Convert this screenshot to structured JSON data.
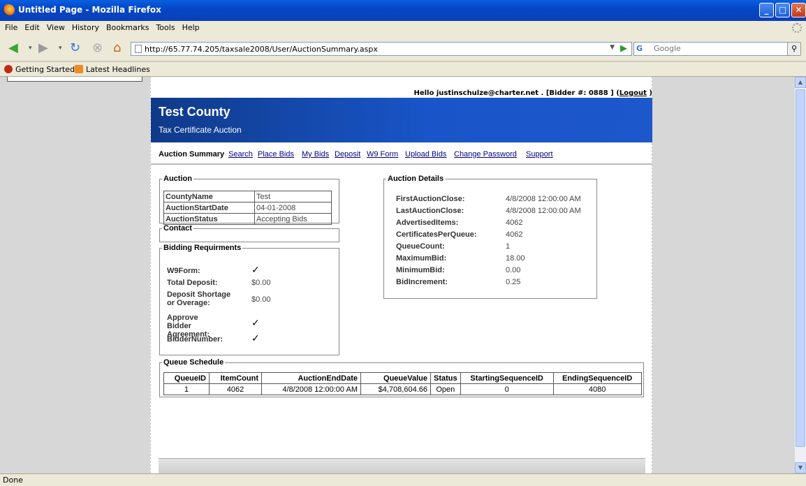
{
  "window": {
    "title": "Untitled Page - Mozilla Firefox"
  },
  "menu": [
    "File",
    "Edit",
    "View",
    "History",
    "Bookmarks",
    "Tools",
    "Help"
  ],
  "address": {
    "url": "http://65.77.74.205/taxsale2008/User/AuctionSummary.aspx"
  },
  "search": {
    "placeholder": "Google",
    "engine": "G"
  },
  "bookmarks": [
    "Getting Started",
    "Latest Headlines"
  ],
  "status": "Done",
  "page": {
    "greeting": "Hello justinschulze@charter.net . [Bidder #: 0888 ] (",
    "logout": "Logout",
    "greeting_end": " )",
    "title": "Test County",
    "subtitle": "Tax Certificate Auction",
    "nav": [
      "Auction Summary",
      "Search",
      "Place Bids",
      "My Bids",
      "Deposit",
      "W9 Form",
      "Upload Bids",
      "Change Password",
      "Support"
    ]
  },
  "auction": {
    "legend": "Auction",
    "rows": [
      {
        "key": "CountyName",
        "value": "Test"
      },
      {
        "key": "AuctionStartDate",
        "value": "04-01-2008"
      },
      {
        "key": "AuctionStatus",
        "value": "Accepting Bids"
      }
    ]
  },
  "contact": {
    "legend": "Contact"
  },
  "bidding": {
    "legend": "Bidding Requirments",
    "items": [
      {
        "label": "W9Form:",
        "value": "✓"
      },
      {
        "label": "Total Deposit:",
        "value": "$0.00"
      },
      {
        "label": "Deposit Shortage or Overage:",
        "value": "$0.00"
      },
      {
        "label": "Approve Bidder Agreement:",
        "value": "✓"
      },
      {
        "label": "BidderNumber:",
        "value": "✓"
      }
    ]
  },
  "details": {
    "legend": "Auction Details",
    "items": [
      {
        "label": "FirstAuctionClose:",
        "value": "4/8/2008 12:00:00 AM"
      },
      {
        "label": "LastAuctionClose:",
        "value": "4/8/2008 12:00:00 AM"
      },
      {
        "label": "AdvertisedItems:",
        "value": "4062"
      },
      {
        "label": "CertificatesPerQueue:",
        "value": "4062"
      },
      {
        "label": "QueueCount:",
        "value": "1"
      },
      {
        "label": "MaximumBid:",
        "value": "18.00"
      },
      {
        "label": "MinimumBid:",
        "value": "0.00"
      },
      {
        "label": "BidIncrement:",
        "value": "0.25"
      }
    ]
  },
  "queue": {
    "legend": "Queue Schedule",
    "headers": [
      "QueueID",
      "ItemCount",
      "AuctionEndDate",
      "QueueValue",
      "Status",
      "StartingSequenceID",
      "EndingSequenceID"
    ],
    "rows": [
      [
        "1",
        "4062",
        "4/8/2008 12:00:00 AM",
        "$4,708,604.66",
        "Open",
        "0",
        "4080"
      ]
    ]
  }
}
